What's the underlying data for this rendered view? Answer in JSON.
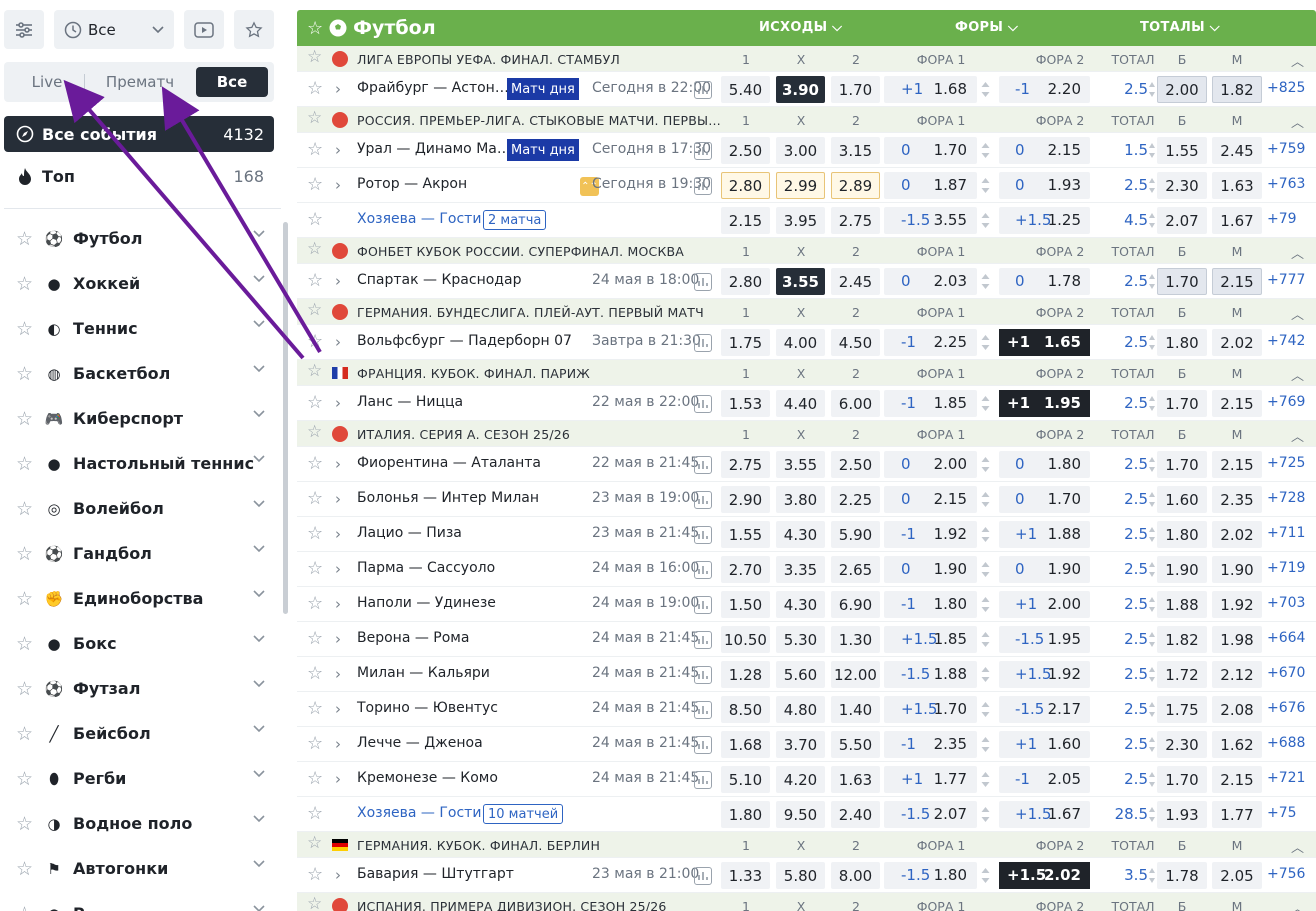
{
  "sidebar": {
    "period_label": "Все",
    "modes": {
      "live": "Live",
      "prematch": "Прематч",
      "all": "Все"
    },
    "all_events": {
      "label": "Все события",
      "count": "4132"
    },
    "top": {
      "label": "Топ",
      "count": "168"
    },
    "sports": [
      {
        "label": "Футбол",
        "icon": "soccer-ball-icon"
      },
      {
        "label": "Хоккей",
        "icon": "hockey-puck-icon"
      },
      {
        "label": "Теннис",
        "icon": "tennis-ball-icon"
      },
      {
        "label": "Баскетбол",
        "icon": "basketball-icon"
      },
      {
        "label": "Киберспорт",
        "icon": "gamepad-icon"
      },
      {
        "label": "Настольный теннис",
        "icon": "table-tennis-icon"
      },
      {
        "label": "Волейбол",
        "icon": "volleyball-icon"
      },
      {
        "label": "Гандбол",
        "icon": "handball-icon"
      },
      {
        "label": "Единоборства",
        "icon": "fist-icon"
      },
      {
        "label": "Бокс",
        "icon": "boxing-glove-icon"
      },
      {
        "label": "Футзал",
        "icon": "futsal-ball-icon"
      },
      {
        "label": "Бейсбол",
        "icon": "baseball-bat-icon"
      },
      {
        "label": "Регби",
        "icon": "rugby-ball-icon"
      },
      {
        "label": "Водное поло",
        "icon": "water-polo-icon"
      },
      {
        "label": "Автогонки",
        "icon": "checkered-flag-icon"
      },
      {
        "label": "Р",
        "icon": "generic-sport-icon"
      }
    ]
  },
  "header": {
    "title": "Футбол",
    "outcomes": "ИСХОДЫ",
    "handicaps": "ФОРЫ",
    "totals": "ТОТАЛЫ",
    "accent": "#6ab04c"
  },
  "col_labels": {
    "c1": "1",
    "cx": "X",
    "c2": "2",
    "f1": "ФОРА 1",
    "f2": "ФОРА 2",
    "total": "ТОТАЛ",
    "over": "Б",
    "under": "М"
  },
  "match_of_day": "Матч дня",
  "rows": [
    {
      "type": "league",
      "name": "ЛИГА ЕВРОПЫ УЕФА. ФИНАЛ. СТАМБУЛ",
      "icon": "uefa-trophy-icon"
    },
    {
      "type": "event",
      "teams": "Фрайбург — Астон…",
      "badge": "md",
      "time": "Сегодня в 22:00",
      "odds": [
        "5.40",
        "3.90",
        "1.70"
      ],
      "sel": [
        1
      ],
      "f1": [
        "+1",
        "1.68"
      ],
      "f2": [
        "-1",
        "2.20"
      ],
      "tot": [
        "2.5",
        "2.00",
        "1.82"
      ],
      "hl": [
        6,
        7
      ],
      "more": "+825"
    },
    {
      "type": "league",
      "name": "РОССИЯ. ПРЕМЬЕР-ЛИГА. СТЫКОВЫЕ МАТЧИ. ПЕРВЫ…",
      "icon": "rpl-ball-icon"
    },
    {
      "type": "event",
      "teams": "Урал — Динамо Ма…",
      "badge": "md",
      "time": "Сегодня в 17:30",
      "odds": [
        "2.50",
        "3.00",
        "3.15"
      ],
      "f1": [
        "0",
        "1.70"
      ],
      "f2": [
        "0",
        "2.15"
      ],
      "tot": [
        "1.5",
        "1.55",
        "2.45"
      ],
      "more": "+759"
    },
    {
      "type": "event",
      "teams": "Ротор — Акрон",
      "upicon": true,
      "time": "Сегодня в 19:30",
      "odds": [
        "2.80",
        "2.99",
        "2.89"
      ],
      "up": [
        0,
        1,
        2
      ],
      "f1": [
        "0",
        "1.87"
      ],
      "f2": [
        "0",
        "1.93"
      ],
      "tot": [
        "2.5",
        "2.30",
        "1.63"
      ],
      "more": "+763"
    },
    {
      "type": "event",
      "link": true,
      "teams": "Хозяева — Гости",
      "countbadge": "2 матча",
      "odds": [
        "2.15",
        "3.95",
        "2.75"
      ],
      "f1": [
        "-1.5",
        "3.55"
      ],
      "f2": [
        "+1.5",
        "1.25"
      ],
      "tot": [
        "4.5",
        "2.07",
        "1.67"
      ],
      "more": "+79"
    },
    {
      "type": "league",
      "name": "ФОНБЕТ КУБОК РОССИИ. СУПЕРФИНАЛ. МОСКВА",
      "icon": "russian-cup-icon"
    },
    {
      "type": "event",
      "teams": "Спартак — Краснодар",
      "time": "24 мая в 18:00",
      "odds": [
        "2.80",
        "3.55",
        "2.45"
      ],
      "sel": [
        1
      ],
      "f1": [
        "0",
        "2.03"
      ],
      "f2": [
        "0",
        "1.78"
      ],
      "tot": [
        "2.5",
        "1.70",
        "2.15"
      ],
      "hl": [
        6,
        7
      ],
      "more": "+777"
    },
    {
      "type": "league",
      "name": "ГЕРМАНИЯ. БУНДЕСЛИГА. ПЛЕЙ-АУТ. ПЕРВЫЙ МАТЧ",
      "icon": "bundesliga-icon"
    },
    {
      "type": "event",
      "teams": "Вольфсбург — Падерборн 07",
      "time": "Завтра в 21:30",
      "odds": [
        "1.75",
        "4.00",
        "4.50"
      ],
      "f1": [
        "-1",
        "2.25"
      ],
      "f2": [
        "+1",
        "1.65"
      ],
      "f2sel": true,
      "tot": [
        "2.5",
        "1.80",
        "2.02"
      ],
      "more": "+742"
    },
    {
      "type": "league",
      "name": "ФРАНЦИЯ. КУБОК. ФИНАЛ. ПАРИЖ",
      "icon": "france-flag-icon"
    },
    {
      "type": "event",
      "teams": "Ланс — Ницца",
      "time": "22 мая в 22:00",
      "odds": [
        "1.53",
        "4.40",
        "6.00"
      ],
      "f1": [
        "-1",
        "1.85"
      ],
      "f2": [
        "+1",
        "1.95"
      ],
      "f2sel": true,
      "tot": [
        "2.5",
        "1.70",
        "2.15"
      ],
      "more": "+769"
    },
    {
      "type": "league",
      "name": "ИТАЛИЯ. СЕРИЯ А. СЕЗОН 25/26",
      "icon": "serie-a-icon",
      "caret": true
    },
    {
      "type": "event",
      "teams": "Фиорентина — Аталанта",
      "time": "22 мая в 21:45",
      "odds": [
        "2.75",
        "3.55",
        "2.50"
      ],
      "f1": [
        "0",
        "2.00"
      ],
      "f2": [
        "0",
        "1.80"
      ],
      "tot": [
        "2.5",
        "1.70",
        "2.15"
      ],
      "more": "+725"
    },
    {
      "type": "event",
      "teams": "Болонья — Интер Милан",
      "time": "23 мая в 19:00",
      "odds": [
        "2.90",
        "3.80",
        "2.25"
      ],
      "f1": [
        "0",
        "2.15"
      ],
      "f2": [
        "0",
        "1.70"
      ],
      "tot": [
        "2.5",
        "1.60",
        "2.35"
      ],
      "more": "+728"
    },
    {
      "type": "event",
      "teams": "Лацио — Пиза",
      "time": "23 мая в 21:45",
      "odds": [
        "1.55",
        "4.30",
        "5.90"
      ],
      "f1": [
        "-1",
        "1.92"
      ],
      "f2": [
        "+1",
        "1.88"
      ],
      "tot": [
        "2.5",
        "1.80",
        "2.02"
      ],
      "more": "+711"
    },
    {
      "type": "event",
      "teams": "Парма — Сассуоло",
      "time": "24 мая в 16:00",
      "odds": [
        "2.70",
        "3.35",
        "2.65"
      ],
      "f1": [
        "0",
        "1.90"
      ],
      "f2": [
        "0",
        "1.90"
      ],
      "tot": [
        "2.5",
        "1.90",
        "1.90"
      ],
      "more": "+719"
    },
    {
      "type": "event",
      "teams": "Наполи — Удинезе",
      "time": "24 мая в 19:00",
      "odds": [
        "1.50",
        "4.30",
        "6.90"
      ],
      "f1": [
        "-1",
        "1.80"
      ],
      "f2": [
        "+1",
        "2.00"
      ],
      "tot": [
        "2.5",
        "1.88",
        "1.92"
      ],
      "more": "+703"
    },
    {
      "type": "event",
      "teams": "Верона — Рома",
      "time": "24 мая в 21:45",
      "odds": [
        "10.50",
        "5.30",
        "1.30"
      ],
      "f1": [
        "+1.5",
        "1.85"
      ],
      "f2": [
        "-1.5",
        "1.95"
      ],
      "tot": [
        "2.5",
        "1.82",
        "1.98"
      ],
      "more": "+664"
    },
    {
      "type": "event",
      "teams": "Милан — Кальяри",
      "time": "24 мая в 21:45",
      "odds": [
        "1.28",
        "5.60",
        "12.00"
      ],
      "f1": [
        "-1.5",
        "1.88"
      ],
      "f2": [
        "+1.5",
        "1.92"
      ],
      "tot": [
        "2.5",
        "1.72",
        "2.12"
      ],
      "more": "+670"
    },
    {
      "type": "event",
      "teams": "Торино — Ювентус",
      "time": "24 мая в 21:45",
      "odds": [
        "8.50",
        "4.80",
        "1.40"
      ],
      "f1": [
        "+1.5",
        "1.70"
      ],
      "f2": [
        "-1.5",
        "2.17"
      ],
      "tot": [
        "2.5",
        "1.75",
        "2.08"
      ],
      "more": "+676"
    },
    {
      "type": "event",
      "teams": "Лечче — Дженоа",
      "time": "24 мая в 21:45",
      "odds": [
        "1.68",
        "3.70",
        "5.50"
      ],
      "f1": [
        "-1",
        "2.35"
      ],
      "f2": [
        "+1",
        "1.60"
      ],
      "tot": [
        "2.5",
        "2.30",
        "1.62"
      ],
      "more": "+688"
    },
    {
      "type": "event",
      "teams": "Кремонезе — Комо",
      "time": "24 мая в 21:45",
      "odds": [
        "5.10",
        "4.20",
        "1.63"
      ],
      "f1": [
        "+1",
        "1.77"
      ],
      "f2": [
        "-1",
        "2.05"
      ],
      "tot": [
        "2.5",
        "1.70",
        "2.15"
      ],
      "more": "+721"
    },
    {
      "type": "event",
      "link": true,
      "teams": "Хозяева — Гости",
      "countbadge": "10 матчей",
      "odds": [
        "1.80",
        "9.50",
        "2.40"
      ],
      "f1": [
        "-1.5",
        "2.07"
      ],
      "f2": [
        "+1.5",
        "1.67"
      ],
      "tot": [
        "28.5",
        "1.93",
        "1.77"
      ],
      "more": "+75"
    },
    {
      "type": "league",
      "name": "ГЕРМАНИЯ. КУБОК. ФИНАЛ. БЕРЛИН",
      "icon": "germany-flag-icon"
    },
    {
      "type": "event",
      "teams": "Бавария — Штутгарт",
      "time": "23 мая в 21:00",
      "odds": [
        "1.33",
        "5.80",
        "8.00"
      ],
      "f1": [
        "-1.5",
        "1.80"
      ],
      "f2": [
        "+1.5",
        "2.02"
      ],
      "f2sel": true,
      "tot": [
        "3.5",
        "1.78",
        "2.05"
      ],
      "more": "+756"
    },
    {
      "type": "league",
      "name": "ИСПАНИЯ. ПРИМЕРА ДИВИЗИОН. СЕЗОН 25/26",
      "icon": "laliga-icon"
    }
  ],
  "annotation": {
    "color": "#6a1b9a",
    "note": "arrows pointing to Live and Прематч mode buttons"
  }
}
